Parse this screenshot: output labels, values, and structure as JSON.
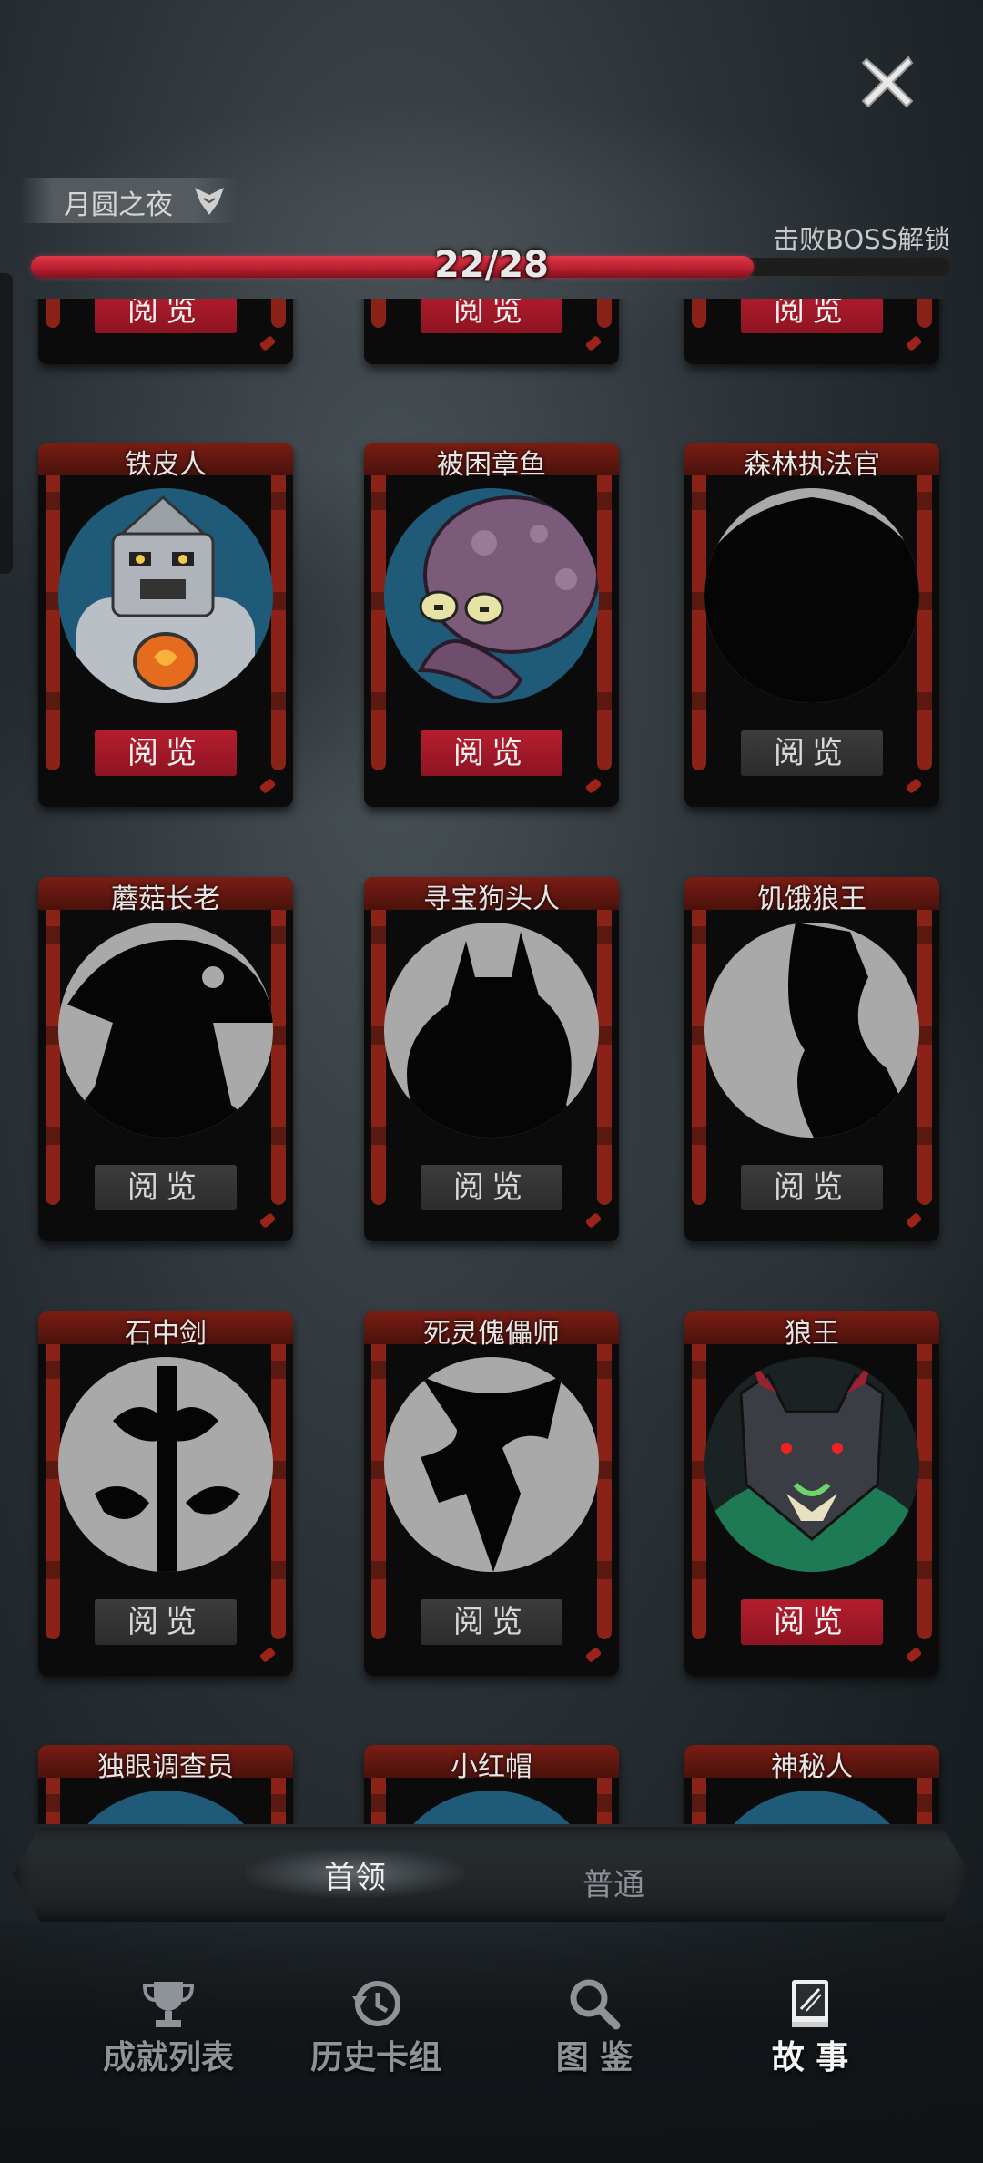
{
  "header": {
    "chapter_label": "月圆之夜",
    "unlock_hint": "击败BOSS解锁",
    "progress_text": "22/28",
    "progress_fraction": 0.7857
  },
  "colors": {
    "accent_red": "#b51d2e",
    "locked_button": "#3c3c3c",
    "frame_red": "#8a2218"
  },
  "top_row": {
    "buttons": [
      {
        "label": "阅览",
        "state": "unlocked"
      },
      {
        "label": "阅览",
        "state": "unlocked"
      },
      {
        "label": "阅览",
        "state": "unlocked"
      }
    ]
  },
  "cards": [
    {
      "name": "铁皮人",
      "button": "阅览",
      "state": "unlocked",
      "portrait": "tin-man"
    },
    {
      "name": "被困章鱼",
      "button": "阅览",
      "state": "unlocked",
      "portrait": "octopus"
    },
    {
      "name": "森林执法官",
      "button": "阅览",
      "state": "locked",
      "portrait": "silhouette"
    },
    {
      "name": "蘑菇长老",
      "button": "阅览",
      "state": "locked",
      "portrait": "silhouette"
    },
    {
      "name": "寻宝狗头人",
      "button": "阅览",
      "state": "locked",
      "portrait": "silhouette"
    },
    {
      "name": "饥饿狼王",
      "button": "阅览",
      "state": "locked",
      "portrait": "silhouette"
    },
    {
      "name": "石中剑",
      "button": "阅览",
      "state": "locked",
      "portrait": "silhouette"
    },
    {
      "name": "死灵傀儡师",
      "button": "阅览",
      "state": "locked",
      "portrait": "silhouette"
    },
    {
      "name": "狼王",
      "button": "阅览",
      "state": "unlocked",
      "portrait": "wolf-king"
    }
  ],
  "bottom_partial_cards": [
    {
      "name": "独眼调查员"
    },
    {
      "name": "小红帽"
    },
    {
      "name": "神秘人"
    }
  ],
  "tabs": [
    {
      "label": "首领",
      "active": true
    },
    {
      "label": "普通",
      "active": false
    }
  ],
  "nav": [
    {
      "label": "成就列表",
      "icon": "trophy-icon",
      "active": false
    },
    {
      "label": "历史卡组",
      "icon": "history-icon",
      "active": false
    },
    {
      "label": "图 鉴",
      "icon": "magnifier-icon",
      "active": false
    },
    {
      "label": "故 事",
      "icon": "book-icon",
      "active": true
    }
  ]
}
